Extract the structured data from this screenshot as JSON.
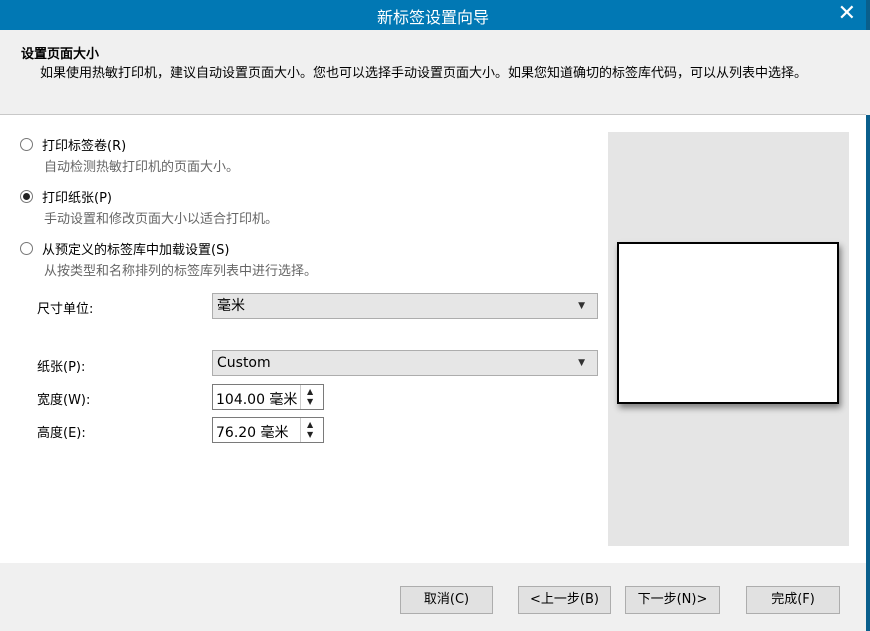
{
  "window": {
    "title": "新标签设置向导"
  },
  "header": {
    "title": "设置页面大小",
    "description": "如果使用热敏打印机，建议自动设置页面大小。您也可以选择手动设置页面大小。如果您知道确切的标签库代码，可以从列表中选择。"
  },
  "options": [
    {
      "label": "打印标签卷(R)",
      "desc": "自动检测热敏打印机的页面大小。",
      "checked": false
    },
    {
      "label": "打印纸张(P)",
      "desc": "手动设置和修改页面大小以适合打印机。",
      "checked": true
    },
    {
      "label": "从预定义的标签库中加载设置(S)",
      "desc": "从按类型和名称排列的标签库列表中进行选择。",
      "checked": false
    }
  ],
  "unit": {
    "label": "尺寸单位:",
    "value": "毫米"
  },
  "paper": {
    "label": "纸张(P):",
    "value": "Custom"
  },
  "width": {
    "label": "宽度(W):",
    "value": "104.00 毫米"
  },
  "height": {
    "label": "高度(E):",
    "value": "76.20 毫米"
  },
  "buttons": {
    "cancel": "取消(C)",
    "back": "<上一步(B)",
    "next": "下一步(N)>",
    "finish": "完成(F)"
  },
  "colors": {
    "titlebar": "#0178b4",
    "preview_bg": "#e5e5e5"
  },
  "icons": {
    "close": "close-icon",
    "dropdown": "chevron-down-icon"
  }
}
